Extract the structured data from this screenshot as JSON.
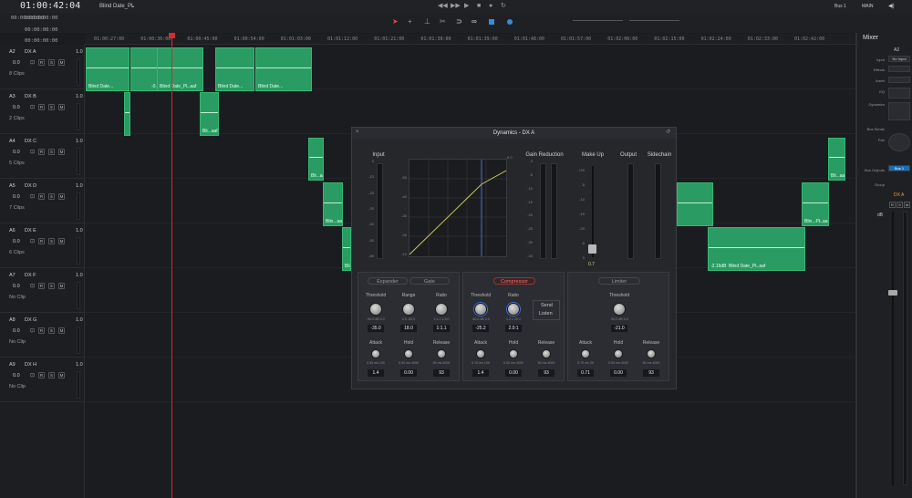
{
  "header": {
    "timecode": "01:00:42:04",
    "timeline_name": "Blind Date_PL",
    "bus": "Bus 1",
    "main": "MAIN"
  },
  "subtimecodes": [
    "00:00:00:00",
    "00:00:00:00",
    "00:00:00:00"
  ],
  "ruler": {
    "ticks": [
      "01:00:27:00",
      "01:00:36:00",
      "01:00:45:00",
      "01:00:54:00",
      "01:01:03:00",
      "01:01:12:00",
      "01:01:21:00",
      "01:01:30:00",
      "01:01:39:00",
      "01:01:48:00",
      "01:01:57:00",
      "01:02:06:00",
      "01:02:15:00",
      "01:02:24:00",
      "01:02:33:00",
      "01:02:42:00"
    ]
  },
  "tracks": [
    {
      "id": "A2",
      "name": "DX A",
      "vol": "0.0",
      "gain": "1.0",
      "clips": "8 Clips"
    },
    {
      "id": "A3",
      "name": "DX B",
      "vol": "0.0",
      "gain": "1.0",
      "clips": "2 Clips"
    },
    {
      "id": "A4",
      "name": "DX C",
      "vol": "0.0",
      "gain": "1.0",
      "clips": "5 Clips"
    },
    {
      "id": "A5",
      "name": "DX D",
      "vol": "0.0",
      "gain": "1.0",
      "clips": "7 Clips"
    },
    {
      "id": "A6",
      "name": "DX E",
      "vol": "0.0",
      "gain": "1.0",
      "clips": "6 Clips"
    },
    {
      "id": "A7",
      "name": "DX F",
      "vol": "0.0",
      "gain": "1.0",
      "clips": "No Clip"
    },
    {
      "id": "A8",
      "name": "DX G",
      "vol": "0.0",
      "gain": "1.0",
      "clips": "No Clip"
    },
    {
      "id": "A9",
      "name": "DX H",
      "vol": "0.0",
      "gain": "1.0",
      "clips": "No Clip"
    }
  ],
  "track_buttons": {
    "r": "R",
    "s": "S",
    "m": "M"
  },
  "clip_labels": {
    "c1": "Blind Date...",
    "c2": "-0.40dB",
    "c3": "Blind Date_PL.aaf",
    "c4": "Blind Date...",
    "c5": "Blind Date...",
    "c6": "Bli...aaf",
    "c7": "Bli...aaf",
    "c8": "Blin...aaf",
    "c9": "Bli...",
    "c10": "Bli...aaf",
    "c11": "Bli...",
    "c12": "Blin...PL.aaf",
    "c13": "-2.16dB",
    "c14": "Blind Date_PL.aaf",
    "c15": "Bli...aaf"
  },
  "mixer": {
    "title": "Mixer",
    "channel": "A2",
    "input_lbl": "Input",
    "input_val": "No Input",
    "effects": "Effects",
    "insert": "Insert",
    "eq": "EQ",
    "dynamics": "Dynamics",
    "bus_sends": "Bus Sends",
    "pan": "Pan",
    "bus_outputs": "Bus Outputs",
    "bus_out_val": "Bus 1",
    "group": "Group",
    "name": "DX A",
    "db": "dB",
    "btn_r": "R",
    "btn_s": "S",
    "btn_m": "M"
  },
  "dynamics": {
    "title": "Dynamics - DX A",
    "input": "Input",
    "gain_reduction": "Gain Reduction",
    "make_up": "Make Up",
    "output": "Output",
    "sidechain": "Sidechain",
    "makeup_val": "0.7",
    "input_scale": [
      "0",
      "-10",
      "-20",
      "-30",
      "-40",
      "-50",
      "-60"
    ],
    "graph_scale": [
      "-50",
      "-40",
      "-30",
      "-20",
      "-10"
    ],
    "graph_top": "0.0",
    "gr_scale": [
      "0",
      "-5",
      "-10",
      "-15",
      "-20",
      "-25",
      "-30",
      "-40"
    ],
    "mu_scale": [
      "+20",
      "-5",
      "-10",
      "-15",
      "-20",
      "-5",
      "0"
    ],
    "expander": {
      "tab": "Expander",
      "gate": "Gate",
      "threshold": "Threshold",
      "range": "Range",
      "ratio": "Ratio",
      "th_range": "-50.0 dB 0.0",
      "rg_range": "0.0 -60.0",
      "ra_range": "1:1.1 1:3.0",
      "th_val": "-35.0",
      "rg_val": "18.0",
      "ra_val": "1:1.1",
      "attack": "Attack",
      "hold": "Hold",
      "release": "Release",
      "at_range": "0.50 ms 100",
      "ho_range": "0.00 ms 4000",
      "re_range": "50 ms 4000",
      "at_val": "1.4",
      "ho_val": "0.00",
      "re_val": "93"
    },
    "compressor": {
      "tab": "Compressor",
      "threshold": "Threshold",
      "ratio": "Ratio",
      "send": "Send",
      "listen": "Listen",
      "th_range": "-50.0 dB 0.0",
      "ra_range": "1.2:1 20:1",
      "th_val": "-25.2",
      "ra_val": "2.0:1",
      "attack": "Attack",
      "hold": "Hold",
      "release": "Release",
      "at_range": "0.70 ms 100",
      "ho_range": "0.00 ms 4000",
      "re_range": "50 ms 4000",
      "at_val": "1.4",
      "ho_val": "0.00",
      "re_val": "93"
    },
    "limiter": {
      "tab": "Limiter",
      "threshold": "Threshold",
      "th_range": "-50.0 dB 0.0",
      "th_val": "-21.0",
      "attack": "Attack",
      "hold": "Hold",
      "release": "Release",
      "at_range": "0.70 ms 30",
      "ho_range": "0.00 ms 4000",
      "re_range": "50 ms 4000",
      "at_val": "0.71",
      "ho_val": "0.00",
      "re_val": "93"
    }
  },
  "colors": {
    "clip": "#2a9b63",
    "playhead": "#d22c2c",
    "compressor_tab": "#e04848"
  }
}
